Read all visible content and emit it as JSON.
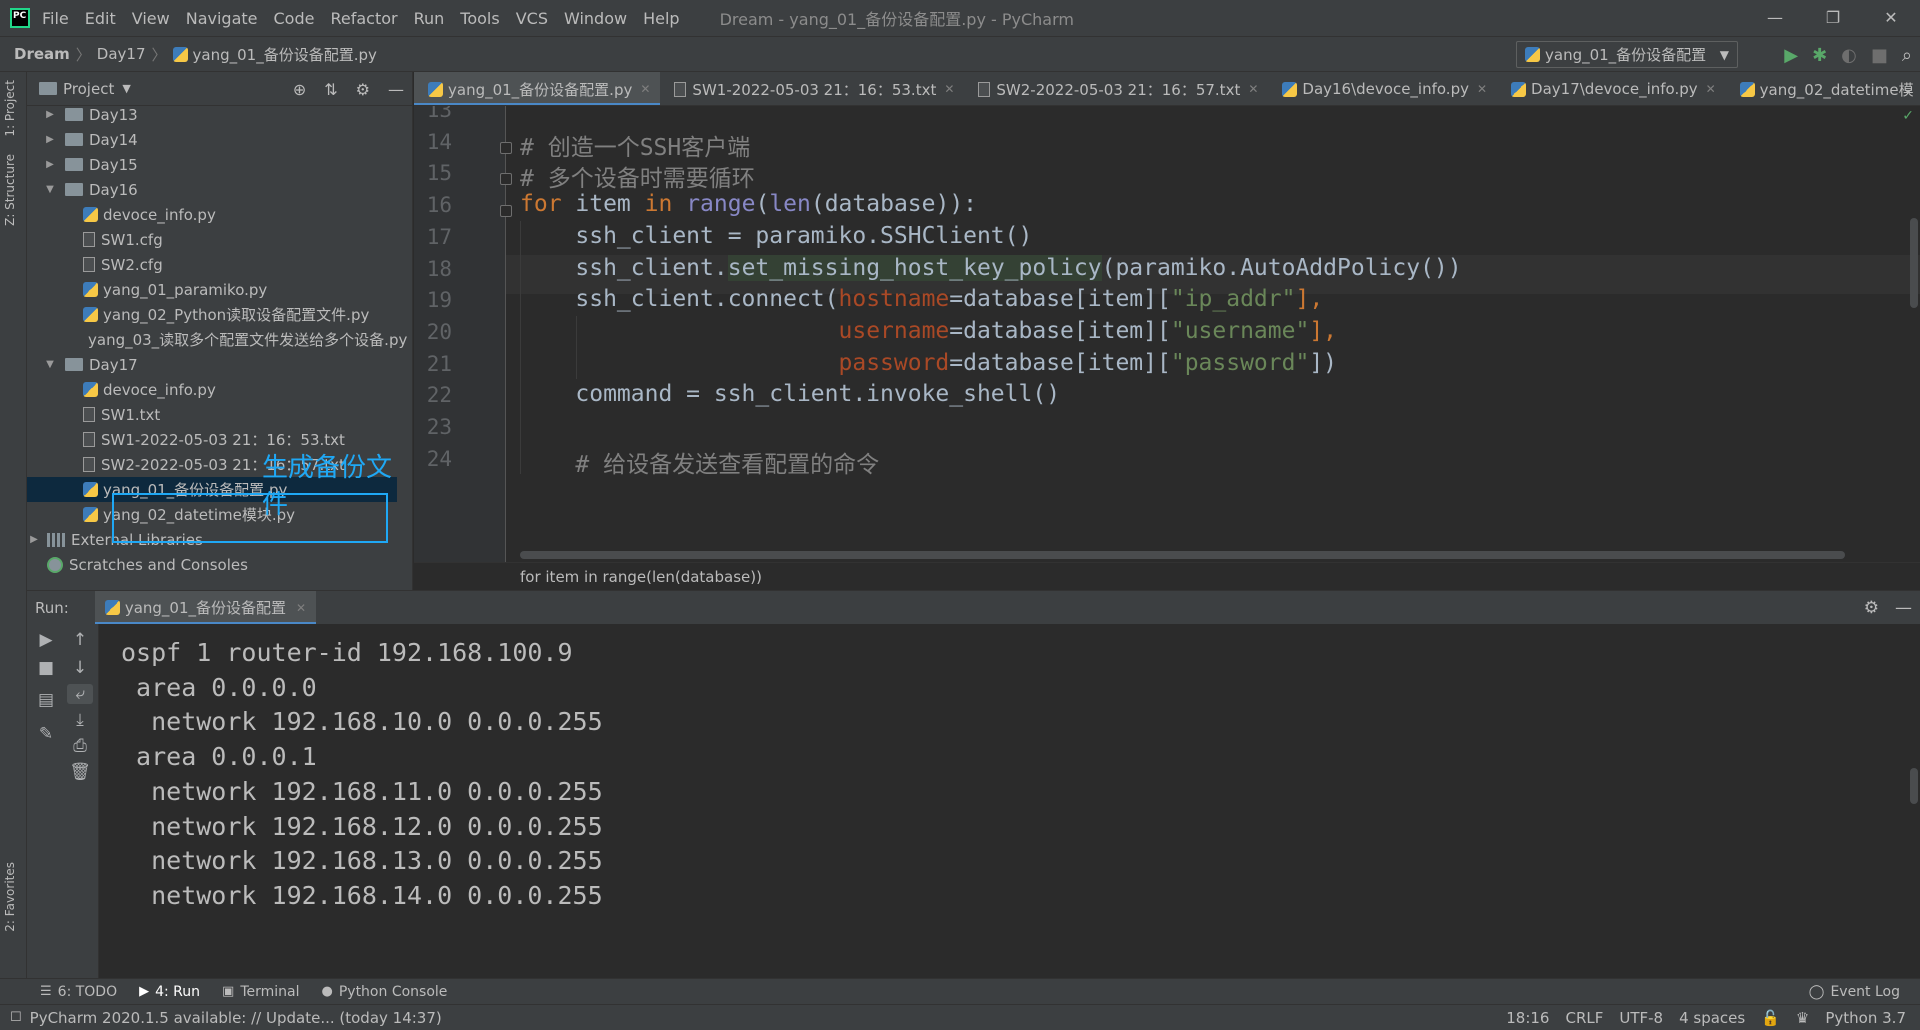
{
  "menu": {
    "items": [
      "File",
      "Edit",
      "View",
      "Navigate",
      "Code",
      "Refactor",
      "Run",
      "Tools",
      "VCS",
      "Window",
      "Help"
    ],
    "window_title": "Dream - yang_01_备份设备配置.py - PyCharm"
  },
  "window_controls": {
    "minimize": "—",
    "restore": "❐",
    "close": "✕"
  },
  "navbar": {
    "crumbs": [
      "Dream",
      "Day17",
      "yang_01_备份设备配置.py"
    ],
    "run_config": "yang_01_备份设备配置"
  },
  "left_strip": {
    "project_tab": "1: Project",
    "structure_tab": "Z: Structure",
    "favorites_tab": "2: Favorites"
  },
  "project_panel": {
    "title": "Project",
    "tree": [
      {
        "label": "Day13",
        "kind": "folder",
        "arrow": "▶",
        "depth": 0
      },
      {
        "label": "Day14",
        "kind": "folder",
        "arrow": "▶",
        "depth": 0
      },
      {
        "label": "Day15",
        "kind": "folder",
        "arrow": "▶",
        "depth": 0
      },
      {
        "label": "Day16",
        "kind": "folder",
        "arrow": "▼",
        "depth": 0
      },
      {
        "label": "devoce_info.py",
        "kind": "py",
        "depth": 1
      },
      {
        "label": "SW1.cfg",
        "kind": "file",
        "depth": 1
      },
      {
        "label": "SW2.cfg",
        "kind": "file",
        "depth": 1
      },
      {
        "label": "yang_01_paramiko.py",
        "kind": "py",
        "depth": 1
      },
      {
        "label": "yang_02_Python读取设备配置文件.py",
        "kind": "py",
        "depth": 1
      },
      {
        "label": "yang_03_读取多个配置文件发送给多个设备.py",
        "kind": "py",
        "depth": 1
      },
      {
        "label": "Day17",
        "kind": "folder",
        "arrow": "▼",
        "depth": 0
      },
      {
        "label": "devoce_info.py",
        "kind": "py",
        "depth": 1
      },
      {
        "label": "SW1.txt",
        "kind": "file",
        "depth": 1
      },
      {
        "label": "SW1-2022-05-03 21：16：53.txt",
        "kind": "file",
        "depth": 1
      },
      {
        "label": "SW2-2022-05-03 21：16：57.txt",
        "kind": "file",
        "depth": 1
      },
      {
        "label": "yang_01_备份设备配置.py",
        "kind": "py",
        "depth": 1,
        "selected": true
      },
      {
        "label": "yang_02_datetime模块.py",
        "kind": "py",
        "depth": 1
      },
      {
        "label": "External Libraries",
        "kind": "lib",
        "arrow": "▶",
        "depth": -1
      },
      {
        "label": "Scratches and Consoles",
        "kind": "scratch",
        "depth": -1
      }
    ],
    "annotation": "生成备份文件"
  },
  "editor_tabs": [
    {
      "label": "yang_01_备份设备配置.py",
      "kind": "py",
      "active": true
    },
    {
      "label": "SW1-2022-05-03 21：16：53.txt",
      "kind": "file"
    },
    {
      "label": "SW2-2022-05-03 21：16：57.txt",
      "kind": "file"
    },
    {
      "label": "Day16\\devoce_info.py",
      "kind": "py"
    },
    {
      "label": "Day17\\devoce_info.py",
      "kind": "py"
    },
    {
      "label": "yang_02_datetime模",
      "kind": "py"
    }
  ],
  "editor": {
    "line_numbers": [
      "13",
      "14",
      "15",
      "16",
      "17",
      "18",
      "19",
      "20",
      "21",
      "22",
      "23",
      "24"
    ],
    "current_line": "18",
    "lines": [
      [],
      [
        {
          "t": "# 创造一个SSH客户端",
          "c": "cmt"
        }
      ],
      [
        {
          "t": "# 多个设备时需要循环",
          "c": "cmt"
        }
      ],
      [
        {
          "t": "for",
          "c": "kw"
        },
        {
          "t": " item ",
          "c": ""
        },
        {
          "t": "in",
          "c": "kw"
        },
        {
          "t": " ",
          "c": ""
        },
        {
          "t": "range",
          "c": "bi"
        },
        {
          "t": "(",
          "c": ""
        },
        {
          "t": "len",
          "c": "bi"
        },
        {
          "t": "(database)):",
          "c": ""
        }
      ],
      [
        {
          "t": "    ssh_client = paramiko.SSHClient()",
          "c": ""
        }
      ],
      [
        {
          "t": "    ssh_client.",
          "c": ""
        },
        {
          "t": "|",
          "c": "caret"
        },
        {
          "t": "set_missing_host_key_policy",
          "c": "hl-method"
        },
        {
          "t": "(paramiko.AutoAddPolicy())",
          "c": ""
        }
      ],
      [
        {
          "t": "    ssh_client.connect(",
          "c": ""
        },
        {
          "t": "hostname",
          "c": "param"
        },
        {
          "t": "=database[item][",
          "c": ""
        },
        {
          "t": "\"ip_addr\"",
          "c": "str"
        },
        {
          "t": "],",
          "c": "kw"
        }
      ],
      [
        {
          "t": "                       ",
          "c": ""
        },
        {
          "t": "username",
          "c": "param"
        },
        {
          "t": "=database[item][",
          "c": ""
        },
        {
          "t": "\"username\"",
          "c": "str"
        },
        {
          "t": "],",
          "c": "kw"
        }
      ],
      [
        {
          "t": "                       ",
          "c": ""
        },
        {
          "t": "password",
          "c": "param"
        },
        {
          "t": "=database[item][",
          "c": ""
        },
        {
          "t": "\"password\"",
          "c": "str"
        },
        {
          "t": "])",
          "c": ""
        }
      ],
      [
        {
          "t": "    command = ssh_client.invoke_shell()",
          "c": ""
        }
      ],
      [],
      [
        {
          "t": "    # 给设备发送查看配置的命令",
          "c": "cmt"
        }
      ]
    ],
    "breadcrumb": "for item in range(len(database))"
  },
  "run_panel": {
    "label": "Run:",
    "tab": "yang_01_备份设备配置",
    "console": [
      "ospf 1 router-id 192.168.100.9",
      " area 0.0.0.0",
      "  network 192.168.10.0 0.0.0.255",
      " area 0.0.0.1",
      "  network 192.168.11.0 0.0.0.255",
      "  network 192.168.12.0 0.0.0.255",
      "  network 192.168.13.0 0.0.0.255",
      "  network 192.168.14.0 0.0.0.255"
    ]
  },
  "bottom_tools": {
    "items": [
      {
        "label": "6: TODO",
        "icon": "☰"
      },
      {
        "label": "4: Run",
        "icon": "▶",
        "active": true
      },
      {
        "label": "Terminal",
        "icon": "▣"
      },
      {
        "label": "Python Console",
        "icon": "●"
      }
    ],
    "event_log": "Event Log"
  },
  "status": {
    "message": "PyCharm 2020.1.5 available: // Update... (today 14:37)",
    "position": "18:16",
    "line_ending": "CRLF",
    "encoding": "UTF-8",
    "indent": "4 spaces",
    "interpreter": "Python 3.7"
  }
}
